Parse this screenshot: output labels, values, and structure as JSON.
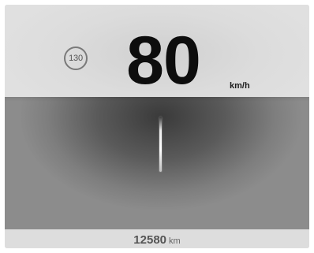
{
  "speed_limit": {
    "value": "130"
  },
  "speedometer": {
    "value": "80",
    "unit": "km/h"
  },
  "odometer": {
    "value": "12580",
    "unit": "km"
  }
}
